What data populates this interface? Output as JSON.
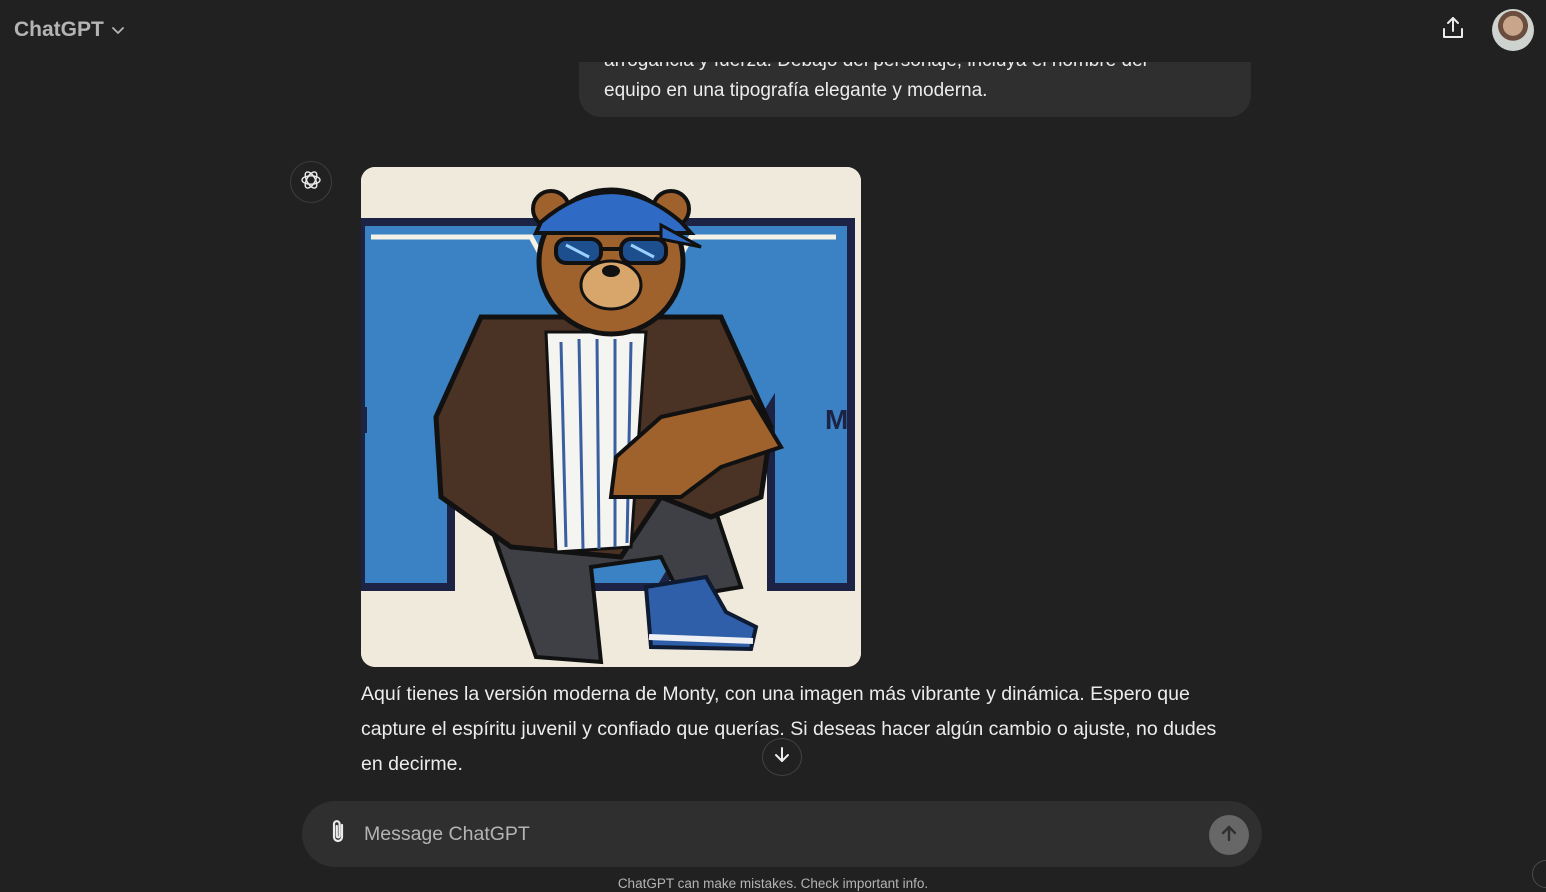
{
  "header": {
    "model_name": "ChatGPT"
  },
  "conversation": {
    "user_message_lines": [
      "arrogancia y fuerza. Debajo del personaje, incluya el nombre del",
      "equipo en una tipografía elegante y moderna."
    ],
    "assistant": {
      "image_initial": "M",
      "lines": [
        "Aquí tienes la versión moderna de Monty, con una imagen más vibrante y dinámica. Espero que",
        "capture el espíritu juvenil y confiado que querías. Si deseas hacer algún cambio o ajuste, no dudes",
        "en decirme."
      ]
    }
  },
  "composer": {
    "placeholder": "Message ChatGPT"
  },
  "footer": {
    "disclaimer": "ChatGPT can make mistakes. Check important info."
  },
  "icons": {
    "model_chevron": "chevron-down-icon",
    "share": "share-icon",
    "assistant": "openai-logo-icon",
    "scroll": "arrow-down-icon",
    "attach": "paperclip-icon",
    "send": "arrow-up-icon"
  },
  "colors": {
    "background": "#212121",
    "bubble": "#2f2f2f",
    "text": "#ececec",
    "muted": "#b4b4b4",
    "send_button": "#676767",
    "letter_blue": "#3b82c4",
    "letter_navy": "#1d2344"
  }
}
